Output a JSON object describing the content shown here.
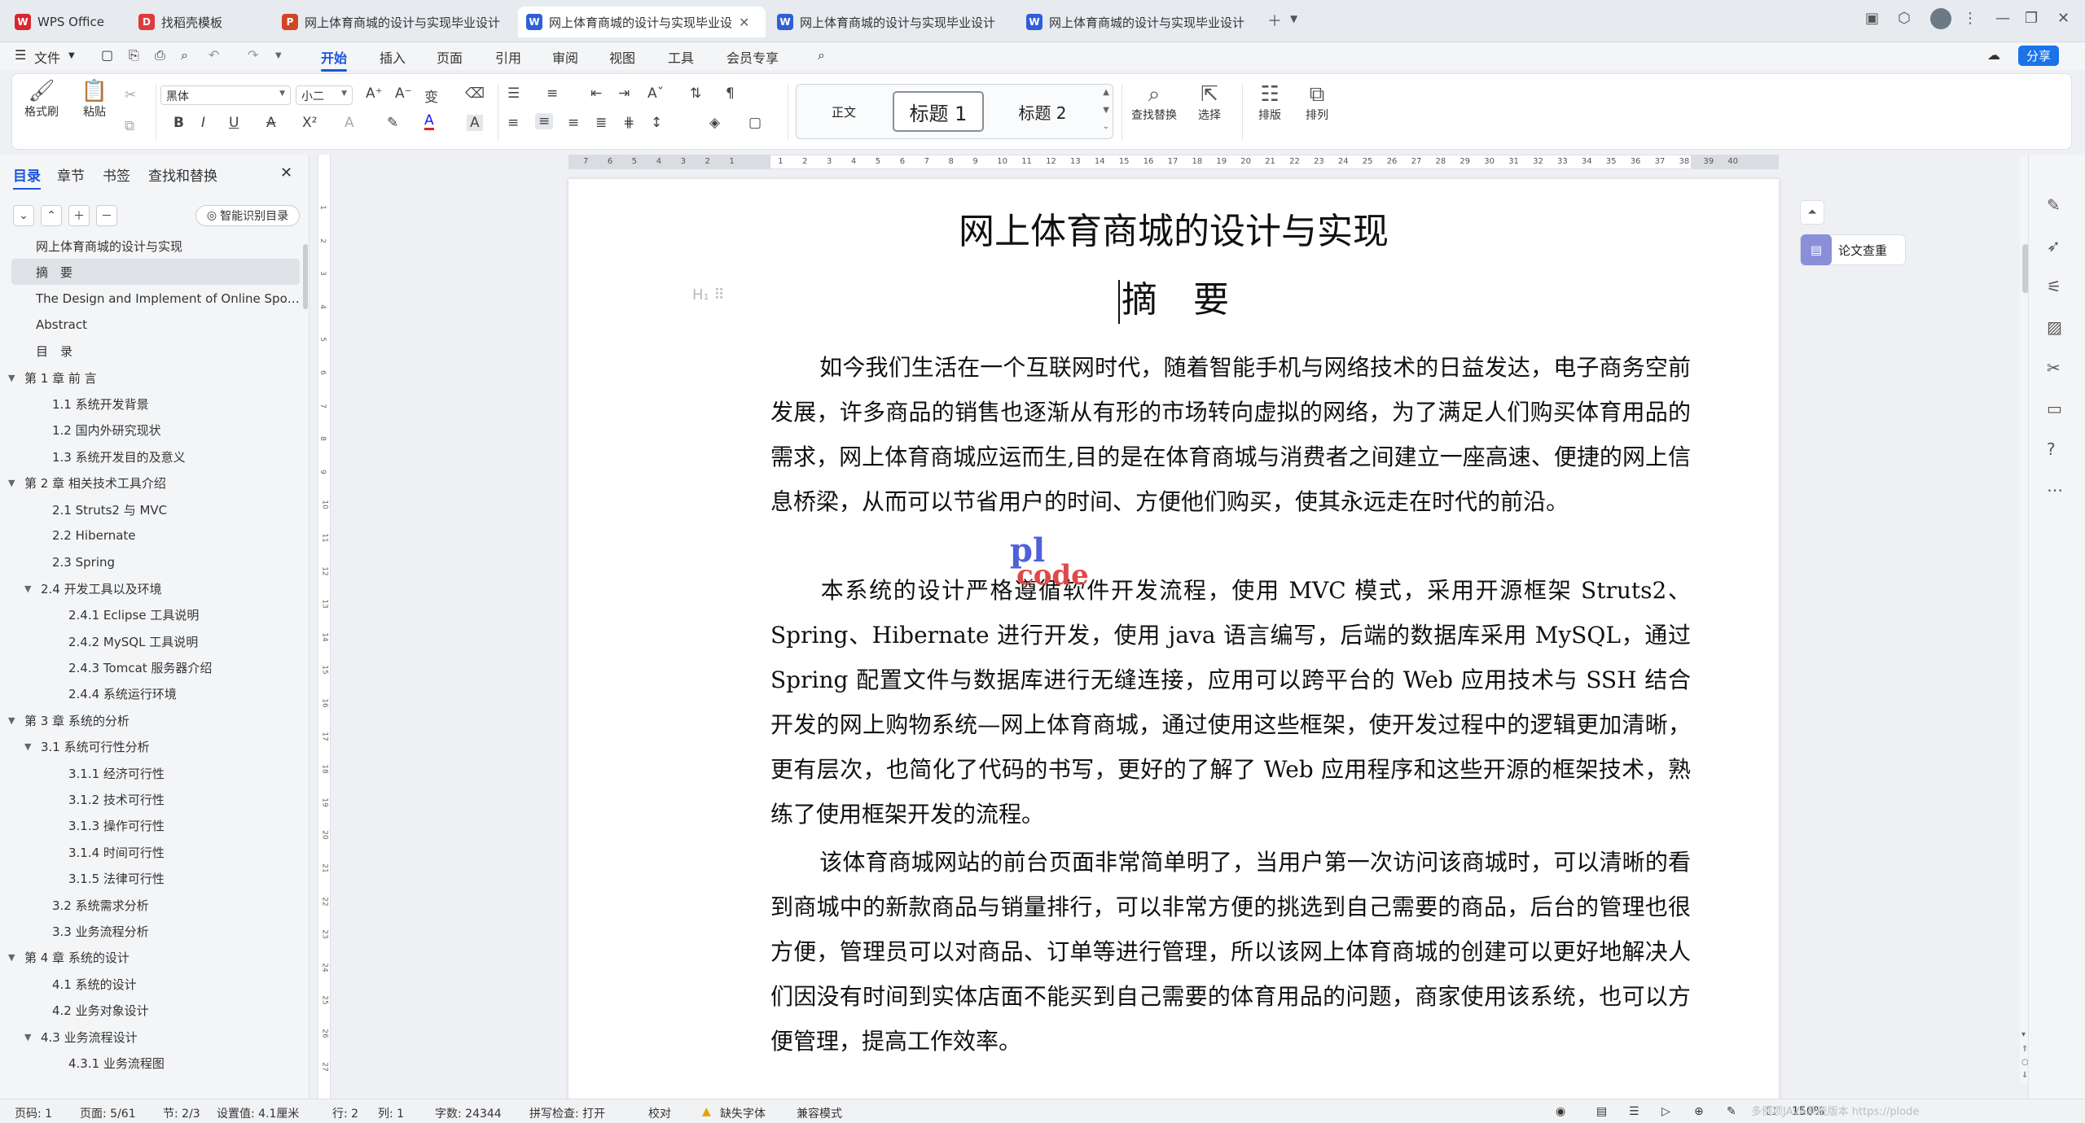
{
  "titlebar": {
    "tabs": [
      {
        "label": "WPS Office",
        "icon": "wps-logo-icon",
        "color": "#d8272f"
      },
      {
        "label": "找稻壳模板",
        "icon": "docer-icon",
        "color": "#e03a3a"
      },
      {
        "label": "网上体育商城的设计与实现毕业设计",
        "icon": "ppt-icon",
        "color": "#d24625"
      },
      {
        "label": "网上体育商城的设计与实现毕业设",
        "icon": "word-icon",
        "color": "#2f5fd8"
      },
      {
        "label": "网上体育商城的设计与实现毕业设计",
        "icon": "word-icon",
        "color": "#2f5fd8"
      },
      {
        "label": "网上体育商城的设计与实现毕业设计",
        "icon": "word-icon",
        "color": "#2f5fd8"
      }
    ]
  },
  "menubar": {
    "file": "文件",
    "items": [
      "开始",
      "插入",
      "页面",
      "引用",
      "审阅",
      "视图",
      "工具",
      "会员专享"
    ],
    "active": "开始",
    "share": "分享"
  },
  "ribbon": {
    "format_painter": "格式刷",
    "paste": "粘贴",
    "font_name": "黑体",
    "font_size": "小二",
    "styles": [
      "正文",
      "标题 1",
      "标题 2"
    ],
    "find_replace": "查找替换",
    "select": "选择",
    "layout": "排版",
    "arrange": "排列"
  },
  "nav": {
    "tabs": [
      "目录",
      "章节",
      "书签",
      "查找和替换"
    ],
    "smart_toc": "智能识别目录",
    "items": [
      {
        "label": "网上体育商城的设计与实现",
        "level": 0,
        "arrow": ""
      },
      {
        "label": "摘　要",
        "level": 0,
        "arrow": "",
        "selected": true
      },
      {
        "label": "The Design and Implement of Online Spo…",
        "level": 0,
        "arrow": ""
      },
      {
        "label": "Abstract",
        "level": 0,
        "arrow": ""
      },
      {
        "label": "目　录",
        "level": 0,
        "arrow": ""
      },
      {
        "label": "第 1 章  前 言",
        "level": 0,
        "arrow": "▼"
      },
      {
        "label": "1.1 系统开发背景",
        "level": 1,
        "arrow": ""
      },
      {
        "label": "1.2 国内外研究现状",
        "level": 1,
        "arrow": ""
      },
      {
        "label": "1.3 系统开发目的及意义",
        "level": 1,
        "arrow": ""
      },
      {
        "label": "第 2 章  相关技术工具介绍",
        "level": 0,
        "arrow": "▼"
      },
      {
        "label": "2.1 Struts2 与 MVC",
        "level": 1,
        "arrow": ""
      },
      {
        "label": "2.2 Hibernate",
        "level": 1,
        "arrow": ""
      },
      {
        "label": "2.3 Spring",
        "level": 1,
        "arrow": ""
      },
      {
        "label": "2.4 开发工具以及环境",
        "level": 1,
        "arrow": "▼"
      },
      {
        "label": "2.4.1 Eclipse 工具说明",
        "level": 2,
        "arrow": ""
      },
      {
        "label": "2.4.2 MySQL 工具说明",
        "level": 2,
        "arrow": ""
      },
      {
        "label": "2.4.3 Tomcat 服务器介绍",
        "level": 2,
        "arrow": ""
      },
      {
        "label": "2.4.4  系统运行环境",
        "level": 2,
        "arrow": ""
      },
      {
        "label": "第 3 章    系统的分析",
        "level": 0,
        "arrow": "▼"
      },
      {
        "label": "3.1  系统可行性分析",
        "level": 1,
        "arrow": "▼"
      },
      {
        "label": "3.1.1  经济可行性",
        "level": 2,
        "arrow": ""
      },
      {
        "label": "3.1.2  技术可行性",
        "level": 2,
        "arrow": ""
      },
      {
        "label": "3.1.3  操作可行性",
        "level": 2,
        "arrow": ""
      },
      {
        "label": "3.1.4  时间可行性",
        "level": 2,
        "arrow": ""
      },
      {
        "label": "3.1.5  法律可行性",
        "level": 2,
        "arrow": ""
      },
      {
        "label": "3.2  系统需求分析",
        "level": 1,
        "arrow": ""
      },
      {
        "label": "3.3  业务流程分析",
        "level": 1,
        "arrow": ""
      },
      {
        "label": "第 4 章    系统的设计",
        "level": 0,
        "arrow": "▼"
      },
      {
        "label": "4.1  系统的设计",
        "level": 1,
        "arrow": ""
      },
      {
        "label": "4.2  业务对象设计",
        "level": 1,
        "arrow": ""
      },
      {
        "label": "4.3  业务流程设计",
        "level": 1,
        "arrow": "▼"
      },
      {
        "label": "4.3.1  业务流程图",
        "level": 2,
        "arrow": ""
      }
    ]
  },
  "document": {
    "title": "网上体育商城的设计与实现",
    "heading": "摘　要",
    "paragraphs": [
      "如今我们生活在一个互联网时代，随着智能手机与网络技术的日益发达，电子商务空前发展，许多商品的销售也逐渐从有形的市场转向虚拟的网络，为了满足人们购买体育用品的需求，网上体育商城应运而生,目的是在体育商城与消费者之间建立一座高速、便捷的网上信息桥梁，从而可以节省用户的时间、方便他们购买，使其永远走在时代的前沿。",
      "本系统的设计严格遵循软件开发流程，使用 MVC 模式，采用开源框架 Struts2、Spring、Hibernate 进行开发，使用 java 语言编写，后端的数据库采用 MySQL，通过 Spring 配置文件与数据库进行无缝连接，应用可以跨平台的 Web 应用技术与 SSH 结合开发的网上购物系统—网上体育商城，通过使用这些框架，使开发过程中的逻辑更加清晰，更有层次，也简化了代码的书写，更好的了解了 Web 应用程序和这些开源的框架技术，熟练了使用框架开发的流程。",
      "该体育商城网站的前台页面非常简单明了，当用户第一次访问该商城时，可以清晰的看到商城中的新款商品与销量排行，可以非常方便的挑选到自己需要的商品，后台的管理也很方便，管理员可以对商品、订单等进行管理，所以该网上体育商城的创建可以更好地解决人们因没有时间到实体店面不能买到自己需要的体育用品的问题，商家使用该系统，也可以方便管理，提高工作效率。"
    ],
    "watermark_top": "pl",
    "watermark_bottom": "code"
  },
  "right": {
    "paper_check": "论文查重"
  },
  "statusbar": {
    "page": "页码: 1",
    "pages": "页面: 5/61",
    "section": "节: 2/3",
    "setting": "设置值: 4.1厘米",
    "row": "行: 2",
    "col": "列: 1",
    "words": "字数: 24344",
    "spell": "拼写检查: 打开",
    "proof": "校对",
    "missing_font": "缺失字体",
    "compat": "兼容模式",
    "zoom": "150%",
    "overlay": "多例项JAVA系统版本 https://plode"
  },
  "ruler_numbers": [
    "7",
    "6",
    "5",
    "4",
    "3",
    "2",
    "1",
    "",
    "1",
    "2",
    "3",
    "4",
    "5",
    "6",
    "7",
    "8",
    "9",
    "10",
    "11",
    "12",
    "13",
    "14",
    "15",
    "16",
    "17",
    "18",
    "19",
    "20",
    "21",
    "22",
    "23",
    "24",
    "25",
    "26",
    "27",
    "28",
    "29",
    "30",
    "31",
    "32",
    "33",
    "34",
    "35",
    "36",
    "37",
    "38",
    "39",
    "40"
  ],
  "vruler_numbers": [
    "1",
    "2",
    "3",
    "4",
    "5",
    "6",
    "7",
    "8",
    "9",
    "10",
    "11",
    "12",
    "13",
    "14",
    "15",
    "16",
    "17",
    "18",
    "19",
    "20",
    "21",
    "22",
    "23",
    "24",
    "25",
    "26",
    "27"
  ]
}
